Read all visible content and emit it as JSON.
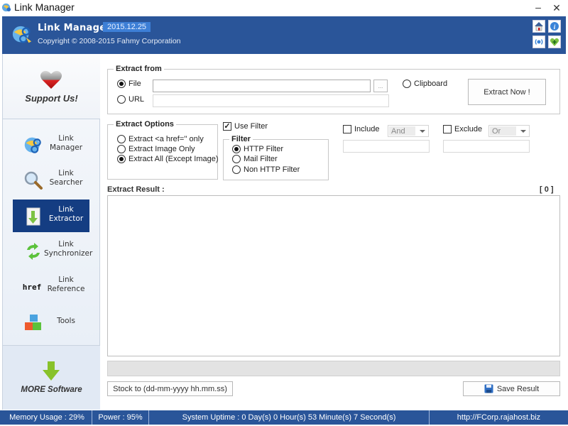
{
  "window": {
    "title": "Link Manager",
    "minimize_glyph": "–",
    "close_glyph": "✕"
  },
  "header": {
    "app_name": "Link Manager",
    "version": "2015.12.25",
    "copyright": "Copyright © 2008-2015 Fahmy Corporation",
    "buttons": [
      {
        "name": "home-icon"
      },
      {
        "name": "info-icon"
      },
      {
        "name": "broadcast-icon"
      },
      {
        "name": "heart-plus-icon"
      }
    ]
  },
  "sidebar": {
    "support_label": "Support Us!",
    "items": [
      {
        "label_line1": "Link",
        "label_line2": "Manager",
        "icon": "link-manager-icon",
        "active": false
      },
      {
        "label_line1": "Link",
        "label_line2": "Searcher",
        "icon": "magnifier-icon",
        "active": false
      },
      {
        "label_line1": "Link",
        "label_line2": "Extractor",
        "icon": "extract-document-icon",
        "active": true
      },
      {
        "label_line1": "Link",
        "label_line2": "Synchronizer",
        "icon": "sync-arrows-icon",
        "active": false
      },
      {
        "label_line1": "Link",
        "label_line2": "Reference",
        "icon": "href-icon",
        "icon_text": "href",
        "active": false
      },
      {
        "label_line1": "Tools",
        "label_line2": "",
        "icon": "tools-cubes-icon",
        "active": false
      }
    ],
    "more_label": "MORE Software"
  },
  "extract_from": {
    "legend": "Extract from",
    "file_label": "File",
    "file_selected": true,
    "file_value": "",
    "browse_label": "...",
    "url_label": "URL",
    "url_selected": false,
    "url_value": "",
    "clipboard_label": "Clipboard",
    "clipboard_selected": false,
    "extract_button": "Extract Now !"
  },
  "extract_options": {
    "legend": "Extract Options",
    "options": [
      {
        "label": "Extract <a href='' only",
        "selected": false
      },
      {
        "label": "Extract Image Only",
        "selected": false
      },
      {
        "label": "Extract All (Except Image)",
        "selected": true
      }
    ]
  },
  "filter": {
    "use_filter_label": "Use Filter",
    "use_filter_checked": true,
    "legend": "Filter",
    "options": [
      {
        "label": "HTTP Filter",
        "selected": true
      },
      {
        "label": "Mail Filter",
        "selected": false
      },
      {
        "label": "Non HTTP Filter",
        "selected": false
      }
    ],
    "include_label": "Include",
    "include_checked": false,
    "include_operator": "And",
    "include_value": "",
    "exclude_label": "Exclude",
    "exclude_checked": false,
    "exclude_operator": "Or",
    "exclude_value": ""
  },
  "result": {
    "label": "Extract Result :",
    "count": "[ 0 ]",
    "content": "",
    "progress": 0,
    "stock_button": "Stock to (dd-mm-yyyy hh.mm.ss)",
    "save_button": "Save Result"
  },
  "statusbar": {
    "memory": "Memory Usage : 29%",
    "power": "Power : 95%",
    "uptime": "System Uptime : 0 Day(s) 0 Hour(s) 53 Minute(s) 7 Second(s)",
    "url": "http://FCorp.rajahost.biz"
  }
}
